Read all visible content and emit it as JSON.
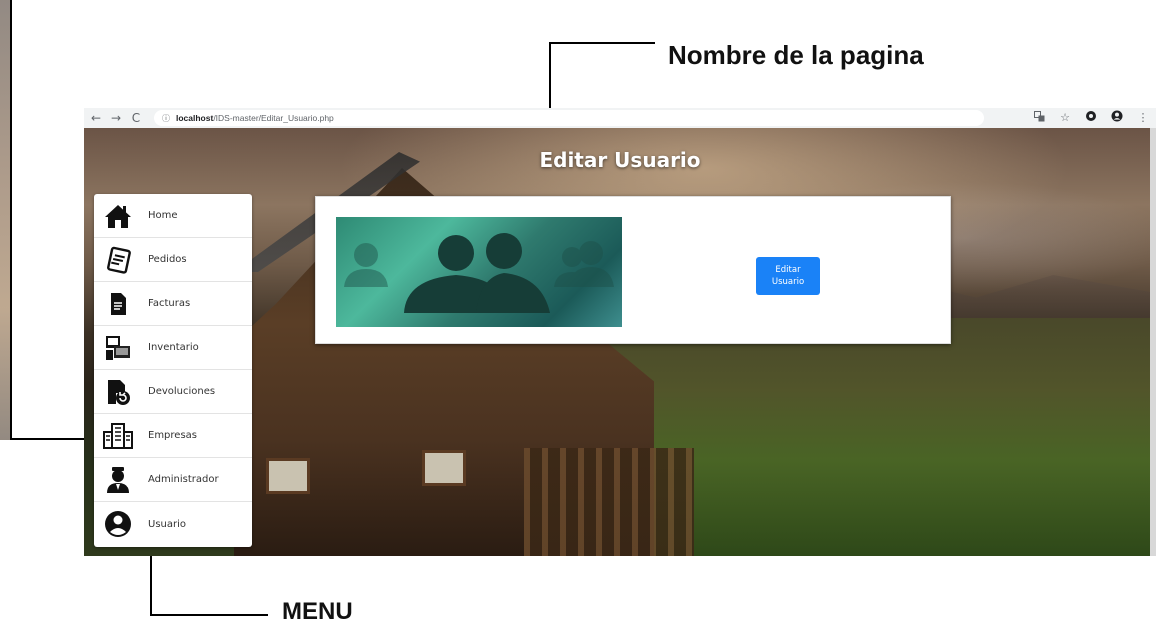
{
  "annotations": {
    "page_name_label": "Nombre de la pagina",
    "menu_label": "MENU"
  },
  "browser": {
    "nav": {
      "back": "←",
      "forward": "→",
      "reload": "C"
    },
    "url": {
      "info_icon": "ⓘ",
      "host": "localhost",
      "path": "/IDS-master/Editar_Usuario.php"
    },
    "tool_icons": [
      "translate-icon",
      "star-icon",
      "extension-icon",
      "account-icon",
      "more-icon"
    ]
  },
  "page": {
    "title": "Editar Usuario",
    "edit_button_label": "Editar Usuario",
    "button_color": "#1a82f7"
  },
  "menu": {
    "items": [
      {
        "label": "Home",
        "icon": "home-icon"
      },
      {
        "label": "Pedidos",
        "icon": "orders-icon"
      },
      {
        "label": "Facturas",
        "icon": "invoice-icon"
      },
      {
        "label": "Inventario",
        "icon": "inventory-icon"
      },
      {
        "label": "Devoluciones",
        "icon": "returns-icon"
      },
      {
        "label": "Empresas",
        "icon": "companies-icon"
      },
      {
        "label": "Administrador",
        "icon": "admin-icon"
      },
      {
        "label": "Usuario",
        "icon": "user-icon"
      }
    ]
  }
}
